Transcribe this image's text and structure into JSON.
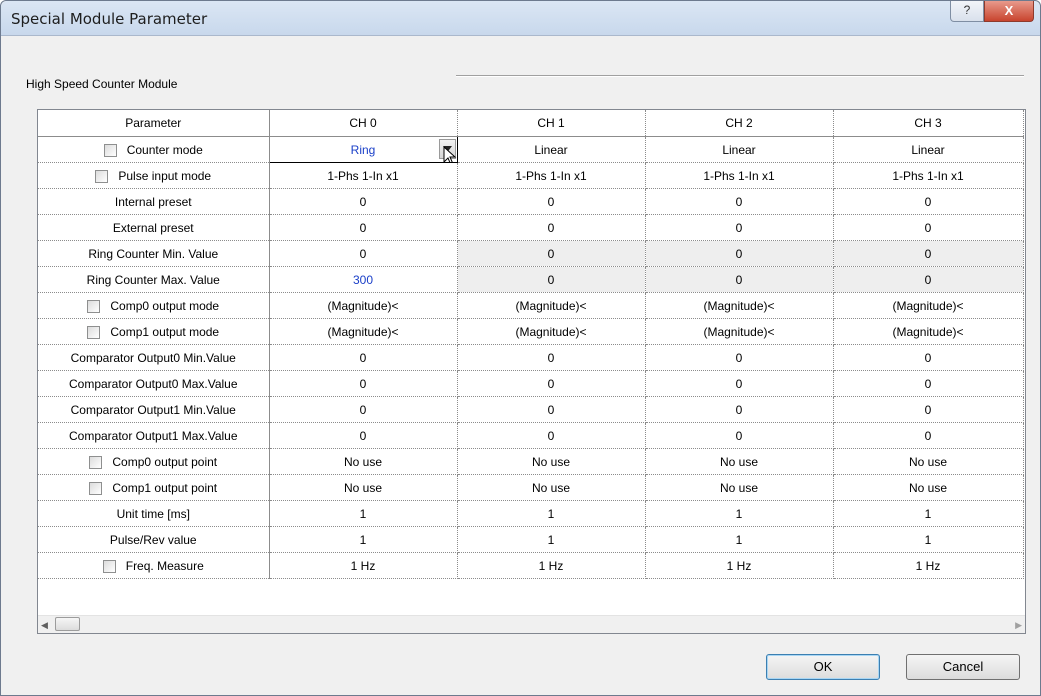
{
  "window": {
    "title": "Special Module Parameter",
    "help_label": "?",
    "close_label": "X"
  },
  "group": {
    "label": "High Speed Counter Module"
  },
  "grid": {
    "headers": [
      "Parameter",
      "CH 0",
      "CH 1",
      "CH 2",
      "CH 3"
    ],
    "rows": [
      {
        "name": "Counter mode",
        "checkbox": true,
        "values": [
          "Ring",
          "Linear",
          "Linear",
          "Linear"
        ]
      },
      {
        "name": "Pulse input mode",
        "checkbox": true,
        "values": [
          "1-Phs 1-In x1",
          "1-Phs 1-In x1",
          "1-Phs 1-In x1",
          "1-Phs 1-In x1"
        ]
      },
      {
        "name": "Internal preset",
        "checkbox": false,
        "values": [
          "0",
          "0",
          "0",
          "0"
        ]
      },
      {
        "name": "External preset",
        "checkbox": false,
        "values": [
          "0",
          "0",
          "0",
          "0"
        ]
      },
      {
        "name": "Ring Counter Min. Value",
        "checkbox": false,
        "values": [
          "0",
          "0",
          "0",
          "0"
        ]
      },
      {
        "name": "Ring Counter Max. Value",
        "checkbox": false,
        "values": [
          "300",
          "0",
          "0",
          "0"
        ]
      },
      {
        "name": "Comp0 output mode",
        "checkbox": true,
        "values": [
          "(Magnitude)<",
          "(Magnitude)<",
          "(Magnitude)<",
          "(Magnitude)<"
        ]
      },
      {
        "name": "Comp1 output mode",
        "checkbox": true,
        "values": [
          "(Magnitude)<",
          "(Magnitude)<",
          "(Magnitude)<",
          "(Magnitude)<"
        ]
      },
      {
        "name": "Comparator Output0 Min.Value",
        "checkbox": false,
        "values": [
          "0",
          "0",
          "0",
          "0"
        ]
      },
      {
        "name": "Comparator Output0 Max.Value",
        "checkbox": false,
        "values": [
          "0",
          "0",
          "0",
          "0"
        ]
      },
      {
        "name": "Comparator Output1 Min.Value",
        "checkbox": false,
        "values": [
          "0",
          "0",
          "0",
          "0"
        ]
      },
      {
        "name": "Comparator Output1 Max.Value",
        "checkbox": false,
        "values": [
          "0",
          "0",
          "0",
          "0"
        ]
      },
      {
        "name": "Comp0 output point",
        "checkbox": true,
        "values": [
          "No use",
          "No use",
          "No use",
          "No use"
        ]
      },
      {
        "name": "Comp1 output point",
        "checkbox": true,
        "values": [
          "No use",
          "No use",
          "No use",
          "No use"
        ]
      },
      {
        "name": "Unit time [ms]",
        "checkbox": false,
        "values": [
          "1",
          "1",
          "1",
          "1"
        ]
      },
      {
        "name": "Pulse/Rev value",
        "checkbox": false,
        "values": [
          "1",
          "1",
          "1",
          "1"
        ]
      },
      {
        "name": "Freq. Measure",
        "checkbox": true,
        "values": [
          "1 Hz",
          "1 Hz",
          "1 Hz",
          "1 Hz"
        ]
      }
    ]
  },
  "scrollbar": {
    "left_arrow": "◀",
    "right_arrow": "▶"
  },
  "buttons": {
    "ok": "OK",
    "cancel": "Cancel"
  },
  "colors": {
    "edited_value": "#1a3fc8",
    "disabled_cell": "#eeeeee"
  }
}
